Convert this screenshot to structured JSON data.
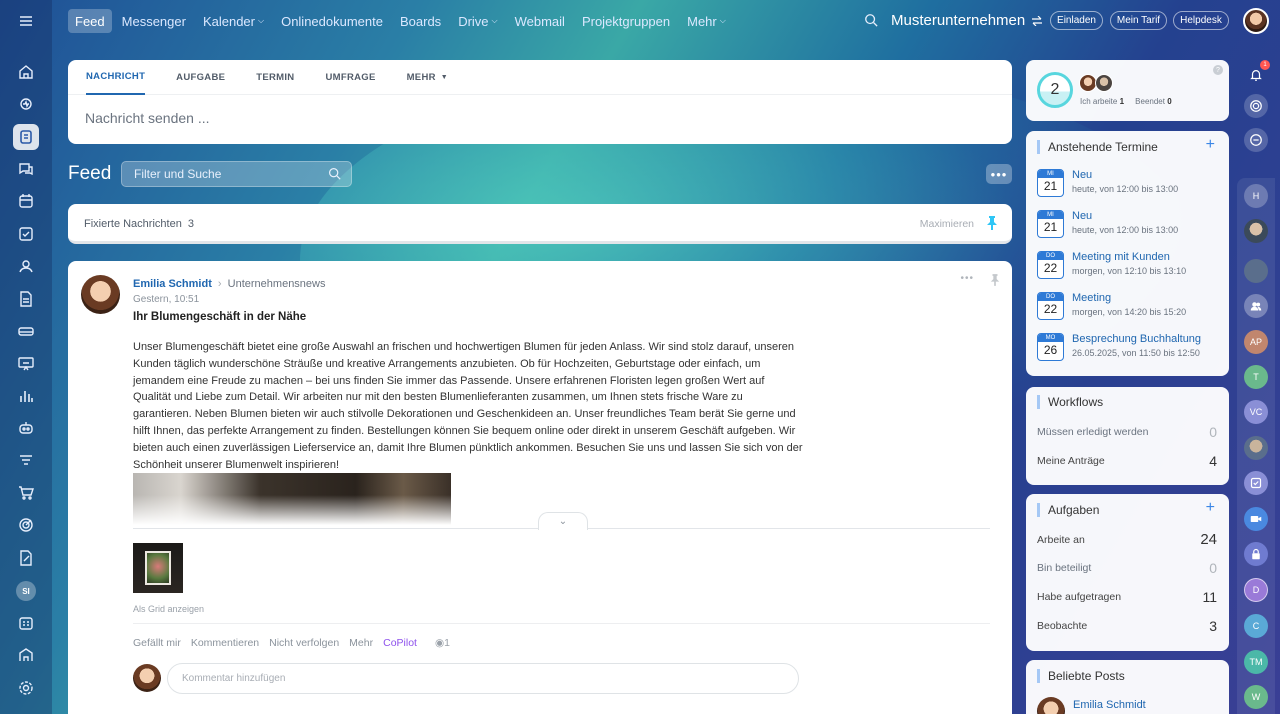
{
  "nav": {
    "items": [
      {
        "label": "Feed",
        "active": true
      },
      {
        "label": "Messenger"
      },
      {
        "label": "Kalender",
        "dropdown": true
      },
      {
        "label": "Onlinedokumente"
      },
      {
        "label": "Boards"
      },
      {
        "label": "Drive",
        "dropdown": true
      },
      {
        "label": "Webmail"
      },
      {
        "label": "Projektgruppen"
      },
      {
        "label": "Mehr",
        "dropdown": true
      }
    ],
    "company": "Musterunternehmen",
    "buttons": {
      "invite": "Einladen",
      "plan": "Mein Tarif",
      "help": "Helpdesk"
    }
  },
  "sidebar": {
    "icons": [
      "menu-icon",
      "home-icon",
      "pulse-icon",
      "feed-icon",
      "chat-icon",
      "calendar-icon",
      "task-icon",
      "contacts-icon",
      "document-icon",
      "drive-icon",
      "presentation-icon",
      "chart-icon",
      "robot-icon",
      "filter-icon",
      "cart-icon",
      "target-icon",
      "sign-icon",
      "user-si",
      "schedule-icon",
      "office-icon",
      "settings-icon"
    ],
    "user_initials": "SI"
  },
  "composer": {
    "tabs": [
      "Nachricht",
      "Aufgabe",
      "Termin",
      "Umfrage",
      "Mehr"
    ],
    "placeholder": "Nachricht senden ..."
  },
  "feed": {
    "title": "Feed",
    "search_placeholder": "Filter und Suche",
    "pinned_label": "Fixierte Nachrichten",
    "pinned_count": "3",
    "maximize": "Maximieren"
  },
  "post": {
    "author": "Emilia Schmidt",
    "group": "Unternehmensnews",
    "time": "Gestern, 10:51",
    "title": "Ihr Blumengeschäft in der Nähe",
    "text": "Unser Blumengeschäft bietet eine große Auswahl an frischen und hochwertigen Blumen für jeden Anlass. Wir sind stolz darauf, unseren Kunden täglich wunderschöne Sträuße und kreative Arrangements anzubieten. Ob für Hochzeiten, Geburtstage oder einfach, um jemandem eine Freude zu machen – bei uns finden Sie immer das Passende. Unsere erfahrenen Floristen legen großen Wert auf Qualität und Liebe zum Detail. Wir arbeiten nur mit den besten Blumenlieferanten zusammen, um Ihnen stets frische Ware zu garantieren. Neben Blumen bieten wir auch stilvolle Dekorationen und Geschenkideen an. Unser freundliches Team berät Sie gerne und hilft Ihnen, das perfekte Arrangement zu finden. Bestellungen können Sie bequem online oder direkt in unserem Geschäft aufgeben. Wir bieten auch einen zuverlässigen Lieferservice an, damit Ihre Blumen pünktlich ankommen. Besuchen Sie uns und lassen Sie sich von der Schönheit unserer Blumenwelt inspirieren!",
    "grid_link": "Als Grid anzeigen",
    "actions": {
      "like": "Gefällt mir",
      "comment": "Kommentieren",
      "unfollow": "Nicht verfolgen",
      "more": "Mehr",
      "copilot": "CoPilot"
    },
    "views": "1",
    "comment_placeholder": "Kommentar hinzufügen"
  },
  "status": {
    "count": "2",
    "working_label": "Ich arbeite",
    "working": "1",
    "done_label": "Beendet",
    "done": "0"
  },
  "termine": {
    "title": "Anstehende Termine",
    "events": [
      {
        "day": "MI",
        "date": "21",
        "title": "Neu",
        "time": "heute, von 12:00 bis 13:00"
      },
      {
        "day": "MI",
        "date": "21",
        "title": "Neu",
        "time": "heute, von 12:00 bis 13:00"
      },
      {
        "day": "DO",
        "date": "22",
        "title": "Meeting mit Kunden",
        "time": "morgen, von 12:10 bis 13:10"
      },
      {
        "day": "DO",
        "date": "22",
        "title": "Meeting",
        "time": "morgen, von 14:20 bis 15:20"
      },
      {
        "day": "MO",
        "date": "26",
        "title": "Besprechung Buchhaltung",
        "time": "26.05.2025, von 11:50 bis 12:50"
      }
    ]
  },
  "workflows": {
    "title": "Workflows",
    "rows": [
      {
        "label": "Müssen erledigt werden",
        "value": "0"
      },
      {
        "label": "Meine Anträge",
        "value": "4"
      }
    ]
  },
  "aufgaben": {
    "title": "Aufgaben",
    "rows": [
      {
        "label": "Arbeite an",
        "value": "24"
      },
      {
        "label": "Bin beteiligt",
        "value": "0"
      },
      {
        "label": "Habe aufgetragen",
        "value": "11"
      },
      {
        "label": "Beobachte",
        "value": "3"
      }
    ]
  },
  "posts": {
    "title": "Beliebte Posts",
    "author": "Emilia Schmidt"
  },
  "rightbar": {
    "notification_count": "1",
    "chats": [
      "H",
      "AP",
      "T",
      "VC",
      "D",
      "C",
      "TM",
      "W"
    ]
  }
}
